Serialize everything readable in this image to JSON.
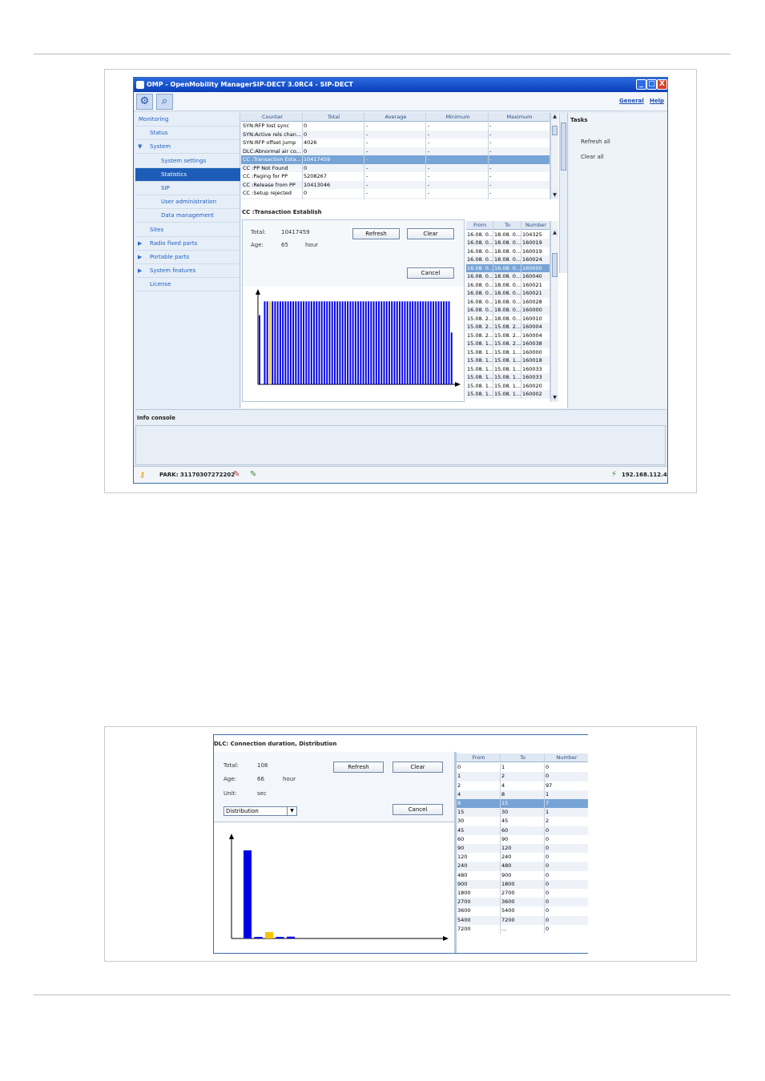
{
  "screenshot1": {
    "title": "OMP - OpenMobility ManagerSIP-DECT 3.0RC4 - SIP-DECT",
    "title_buttons": [
      "_",
      "□",
      "X"
    ],
    "toolbar_icons": [
      "gear-icon",
      "search-icon"
    ],
    "links": {
      "general": "General",
      "help": "Help"
    },
    "nav": [
      {
        "label": "Monitoring",
        "indent": 0,
        "sel": false,
        "tri": ""
      },
      {
        "label": "Status",
        "indent": 1,
        "sel": false,
        "tri": ""
      },
      {
        "label": "System",
        "indent": 1,
        "sel": false,
        "tri": "▼"
      },
      {
        "label": "System settings",
        "indent": 2,
        "sel": false,
        "tri": ""
      },
      {
        "label": "Statistics",
        "indent": 2,
        "sel": true,
        "tri": ""
      },
      {
        "label": "SIP",
        "indent": 2,
        "sel": false,
        "tri": ""
      },
      {
        "label": "User administration",
        "indent": 2,
        "sel": false,
        "tri": ""
      },
      {
        "label": "Data management",
        "indent": 2,
        "sel": false,
        "tri": ""
      },
      {
        "label": "Sites",
        "indent": 1,
        "sel": false,
        "tri": ""
      },
      {
        "label": "Radio fixed parts",
        "indent": 1,
        "sel": false,
        "tri": "▶"
      },
      {
        "label": "Portable parts",
        "indent": 1,
        "sel": false,
        "tri": "▶"
      },
      {
        "label": "System features",
        "indent": 1,
        "sel": false,
        "tri": "▶"
      },
      {
        "label": "License",
        "indent": 1,
        "sel": false,
        "tri": ""
      }
    ],
    "counter_headers": [
      "Counter",
      "Total",
      "Average",
      "Minimum",
      "Maximum"
    ],
    "counter_rows": [
      [
        "SYN:RFP lost sync",
        "0",
        "-",
        "-",
        "-"
      ],
      [
        "SYN:Active rels chan...",
        "0",
        "-",
        "-",
        "-"
      ],
      [
        "SYN:RFP offset jump",
        "4026",
        "-",
        "-",
        "-"
      ],
      [
        "DLC:Abnormal air co...",
        "0",
        "-",
        "-",
        "-"
      ],
      [
        "CC :Transaction Esta...",
        "10417459",
        "-",
        "-",
        "-"
      ],
      [
        "CC :PP Not Found",
        "0",
        "-",
        "-",
        "-"
      ],
      [
        "CC :Paging for PP",
        "5208267",
        "-",
        "-",
        "-"
      ],
      [
        "CC :Release from PP",
        "10413046",
        "-",
        "-",
        "-"
      ],
      [
        "CC :Setup rejected",
        "0",
        "-",
        "-",
        "-"
      ],
      [
        "NWK:DF Retranslatio",
        "0",
        "-",
        "-",
        "-"
      ]
    ],
    "counter_selected": 4,
    "detail_title": "CC :Transaction Establish",
    "total_label": "Total:",
    "total_value": "10417459",
    "age_label": "Age:",
    "age_value": "65",
    "age_unit": "hour",
    "refresh": "Refresh",
    "clear": "Clear",
    "cancel": "Cancel",
    "dist_headers": [
      "From",
      "To",
      "Number"
    ],
    "dist_rows": [
      [
        "16.08. 0...",
        "18.08. 0...",
        "104325"
      ],
      [
        "16.08. 0...",
        "18.08. 0...",
        "160019"
      ],
      [
        "16.08. 0...",
        "18.08. 0...",
        "160019"
      ],
      [
        "16.08. 0...",
        "18.08. 0...",
        "160024"
      ],
      [
        "16.08. 0...",
        "16.08. 0...",
        "160000"
      ],
      [
        "16.08. 0...",
        "18.08. 0...",
        "160040"
      ],
      [
        "16.08. 0...",
        "18.08. 0...",
        "160021"
      ],
      [
        "16.08. 0...",
        "18.08. 0...",
        "160021"
      ],
      [
        "16.08. 0...",
        "18.08. 0...",
        "160028"
      ],
      [
        "16.08. 0...",
        "18.08. 0...",
        "160000"
      ],
      [
        "15.08. 2...",
        "18.08. 0...",
        "160010"
      ],
      [
        "15.08. 2...",
        "15.08. 2...",
        "160004"
      ],
      [
        "15.08. 2...",
        "15.08. 2...",
        "160004"
      ],
      [
        "15.08. 1...",
        "15.08. 2...",
        "160038"
      ],
      [
        "15.08. 1...",
        "15.08. 1...",
        "160000"
      ],
      [
        "15.08. 1...",
        "15.08. 1...",
        "160018"
      ],
      [
        "15.08. 1...",
        "15.08. 1...",
        "160033"
      ],
      [
        "15.08. 1...",
        "15.08. 1...",
        "160033"
      ],
      [
        "15.08. 1...",
        "15.08. 1...",
        "160020"
      ],
      [
        "15.08. 1...",
        "15.08. 1...",
        "160002"
      ]
    ],
    "dist_selected": 4,
    "tasks_title": "Tasks",
    "tasks": [
      "Refresh all",
      "Clear all"
    ],
    "info_console": "Info console",
    "park": "PARK: 31170307272202",
    "ip": "192.168.112.43",
    "status_icons": [
      "key-icon",
      "pen-red-icon",
      "pen-green-icon",
      "network-icon"
    ]
  },
  "screenshot2": {
    "title": "DLC: Connection duration, Distribution",
    "total_label": "Total:",
    "total_value": "108",
    "age_label": "Age:",
    "age_value": "66",
    "age_unit": "hour",
    "unit_label": "Unit:",
    "unit_value": "sec",
    "select_value": "Distribution",
    "refresh": "Refresh",
    "clear": "Clear",
    "cancel": "Cancel",
    "dist_headers": [
      "From",
      "To",
      "Number"
    ],
    "dist_rows": [
      [
        "0",
        "1",
        "0"
      ],
      [
        "1",
        "2",
        "0"
      ],
      [
        "2",
        "4",
        "97"
      ],
      [
        "4",
        "8",
        "1"
      ],
      [
        "8",
        "15",
        "7"
      ],
      [
        "15",
        "30",
        "1"
      ],
      [
        "30",
        "45",
        "2"
      ],
      [
        "45",
        "60",
        "0"
      ],
      [
        "60",
        "90",
        "0"
      ],
      [
        "90",
        "120",
        "0"
      ],
      [
        "120",
        "240",
        "0"
      ],
      [
        "240",
        "480",
        "0"
      ],
      [
        "480",
        "900",
        "0"
      ],
      [
        "900",
        "1800",
        "0"
      ],
      [
        "1800",
        "2700",
        "0"
      ],
      [
        "2700",
        "3600",
        "0"
      ],
      [
        "3600",
        "5400",
        "0"
      ],
      [
        "5400",
        "7200",
        "0"
      ],
      [
        "7200",
        "...",
        "0"
      ]
    ],
    "dist_selected": 4
  },
  "chart_data": [
    {
      "type": "bar",
      "values": [
        0.8,
        0,
        0.96,
        0.96,
        0.96,
        0.96,
        0.96,
        0.96,
        0.96,
        0.96,
        0.96,
        0.96,
        0.96,
        0.96,
        0.96,
        0.96,
        0.96,
        0.96,
        0.96,
        0.96,
        0.96,
        0.96,
        0.96,
        0.96,
        0.96,
        0.96,
        0.96,
        0.96,
        0.96,
        0.96,
        0.96,
        0.96,
        0.96,
        0.96,
        0.96,
        0.96,
        0.96,
        0.96,
        0.96,
        0.96,
        0.96,
        0.96,
        0.96,
        0.96,
        0.96,
        0.96,
        0.96,
        0.96,
        0.96,
        0.96,
        0.96,
        0.96,
        0.96,
        0.96,
        0.96,
        0.96,
        0.96,
        0.96,
        0.96,
        0.96,
        0.96,
        0.96,
        0.96,
        0.96,
        0.96,
        0.96,
        0.96,
        0.96,
        0.96,
        0.96,
        0.96,
        0.96,
        0.96,
        0.96,
        0.6
      ],
      "highlight_index": 4,
      "colors": {
        "bar": "#0000e8",
        "highlight": "#f5c400"
      }
    },
    {
      "type": "bar",
      "categories": [
        "0",
        "1",
        "2",
        "4",
        "8",
        "15",
        "30",
        "45",
        "60",
        "90",
        "120",
        "240",
        "480",
        "900",
        "1800",
        "2700",
        "3600",
        "5400",
        "7200"
      ],
      "values": [
        0,
        0,
        97,
        1,
        7,
        1,
        2,
        0,
        0,
        0,
        0,
        0,
        0,
        0,
        0,
        0,
        0,
        0,
        0
      ],
      "highlight_index": 4,
      "colors": {
        "bar": "#0000e8",
        "highlight": "#f5c400"
      }
    }
  ]
}
